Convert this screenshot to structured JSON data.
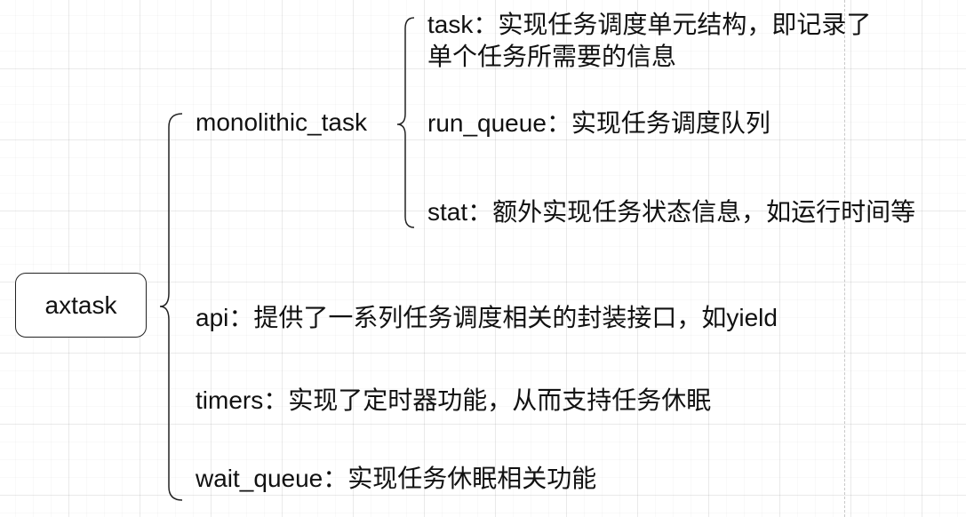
{
  "root": {
    "label": "axtask"
  },
  "children": [
    {
      "id": "monolithic_task",
      "label": "monolithic_task",
      "children": [
        {
          "id": "task",
          "label": "task：实现任务调度单元结构，即记录了单个任务所需要的信息"
        },
        {
          "id": "run_queue",
          "label": "run_queue：实现任务调度队列"
        },
        {
          "id": "stat",
          "label": "stat：额外实现任务状态信息，如运行时间等"
        }
      ]
    },
    {
      "id": "api",
      "label": "api：提供了一系列任务调度相关的封装接口，如yield"
    },
    {
      "id": "timers",
      "label": "timers：实现了定时器功能，从而支持任务休眠"
    },
    {
      "id": "wait_queue",
      "label": "wait_queue：实现任务休眠相关功能"
    }
  ],
  "colors": {
    "line": "#222222",
    "background": "#ffffff",
    "grid": "#e6e6e6"
  }
}
